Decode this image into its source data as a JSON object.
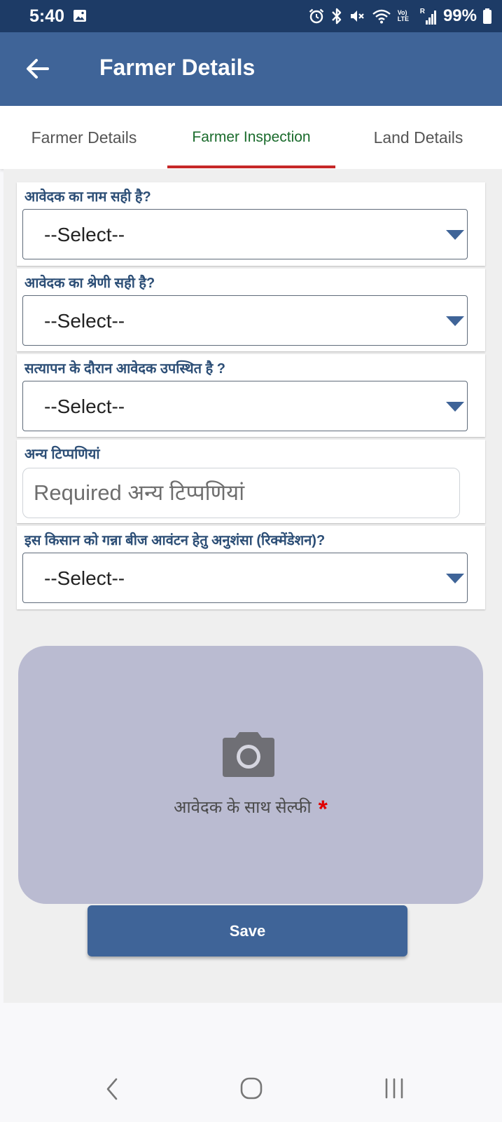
{
  "status_bar": {
    "time": "5:40",
    "battery": "99%",
    "icons": [
      "gallery-icon",
      "alarm-icon",
      "bluetooth-icon",
      "mute-icon",
      "wifi-icon",
      "volte-icon",
      "signal-icon",
      "battery-icon"
    ],
    "volte_text": "Vo) LTE",
    "roaming_text": "R"
  },
  "app_bar": {
    "title": "Farmer Details",
    "back_icon": "back-arrow-icon",
    "background": "#3f6498"
  },
  "tabs": [
    {
      "label": "Farmer Details",
      "selected": false
    },
    {
      "label": "Farmer Inspection",
      "selected": true
    },
    {
      "label": "Land Details",
      "selected": false
    }
  ],
  "form": {
    "fields": [
      {
        "label": "आवेदक का नाम सही है?",
        "value": "--Select--"
      },
      {
        "label": "आवेदक का श्रेणी सही है?",
        "value": "--Select--"
      },
      {
        "label": "सत्यापन के दौरान आवेदक उपस्थित है ?",
        "value": "--Select--"
      }
    ],
    "comments": {
      "label": "अन्य टिप्पणियां",
      "placeholder": "Required अन्य टिप्पणियां",
      "value": ""
    },
    "recommendation": {
      "label": "इस किसान को गन्ना  बीज आवंटन हेतु अनुशंसा (रिक्मेंडेशन)?",
      "value": "--Select--"
    },
    "selfie": {
      "label": "आवेदक के साथ सेल्फी",
      "required_mark": "*",
      "icon": "camera-icon"
    },
    "save_label": "Save"
  },
  "colors": {
    "status_bar": "#1d3b66",
    "primary": "#3f6498",
    "field_label": "#2c4e76",
    "active_tab_text": "#1a6b2c",
    "tab_indicator": "#c62828",
    "dropdown_arrow": "#3f6498",
    "selfie_background": "#babbd1",
    "required": "#e00000"
  },
  "nav_bar": {
    "icons": [
      "back-nav-icon",
      "home-nav-icon",
      "recents-nav-icon"
    ]
  }
}
